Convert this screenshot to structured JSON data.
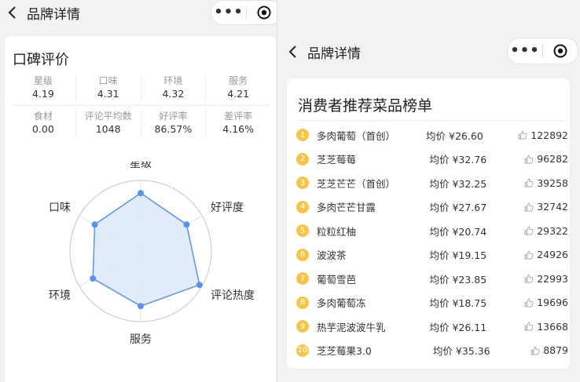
{
  "left": {
    "nav": {
      "title": "品牌详情",
      "more_glyph": "•••"
    },
    "section_title": "口碑评价",
    "stats_rows": [
      [
        {
          "label": "星级",
          "value": "4.19"
        },
        {
          "label": "口味",
          "value": "4.31"
        },
        {
          "label": "环境",
          "value": "4.32"
        },
        {
          "label": "服务",
          "value": "4.21"
        }
      ],
      [
        {
          "label": "食材",
          "value": "0.00"
        },
        {
          "label": "评论平均数",
          "value": "1048"
        },
        {
          "label": "好评率",
          "value": "86.57%"
        },
        {
          "label": "差评率",
          "value": "4.16%"
        }
      ]
    ],
    "radar": {
      "axes": [
        "星级",
        "好评度",
        "评论热度",
        "服务",
        "环境",
        "口味"
      ],
      "values": [
        0.82,
        0.75,
        0.96,
        0.78,
        0.78,
        0.75
      ],
      "fill_color": "#dce8fb",
      "stroke_color": "#5b93ea",
      "grid_color": "#cfcfcf"
    }
  },
  "right": {
    "nav": {
      "title": "品牌详情",
      "more_glyph": "•••"
    },
    "section_title": "消费者推荐菜品榜单",
    "price_prefix": "均价 ¥",
    "rank_color": "#f4c54a",
    "items": [
      {
        "rank": "1",
        "name": "多肉葡萄（首创）",
        "price": "26.60",
        "likes": "122892"
      },
      {
        "rank": "2",
        "name": "芝芝莓莓",
        "price": "32.76",
        "likes": "96282"
      },
      {
        "rank": "3",
        "name": "芝芝芒芒（首创）",
        "price": "32.25",
        "likes": "39258"
      },
      {
        "rank": "4",
        "name": "多肉芒芒甘露",
        "price": "27.67",
        "likes": "32742"
      },
      {
        "rank": "5",
        "name": "粒粒红柚",
        "price": "20.74",
        "likes": "29322"
      },
      {
        "rank": "6",
        "name": "波波茶",
        "price": "19.15",
        "likes": "24926"
      },
      {
        "rank": "7",
        "name": "葡萄雪芭",
        "price": "23.85",
        "likes": "22993"
      },
      {
        "rank": "8",
        "name": "多肉葡萄冻",
        "price": "18.75",
        "likes": "19696"
      },
      {
        "rank": "9",
        "name": "热芋泥波波牛乳",
        "price": "26.11",
        "likes": "13668"
      },
      {
        "rank": "10",
        "name": "芝芝莓果3.0",
        "price": "35.36",
        "likes": "8879"
      }
    ]
  }
}
